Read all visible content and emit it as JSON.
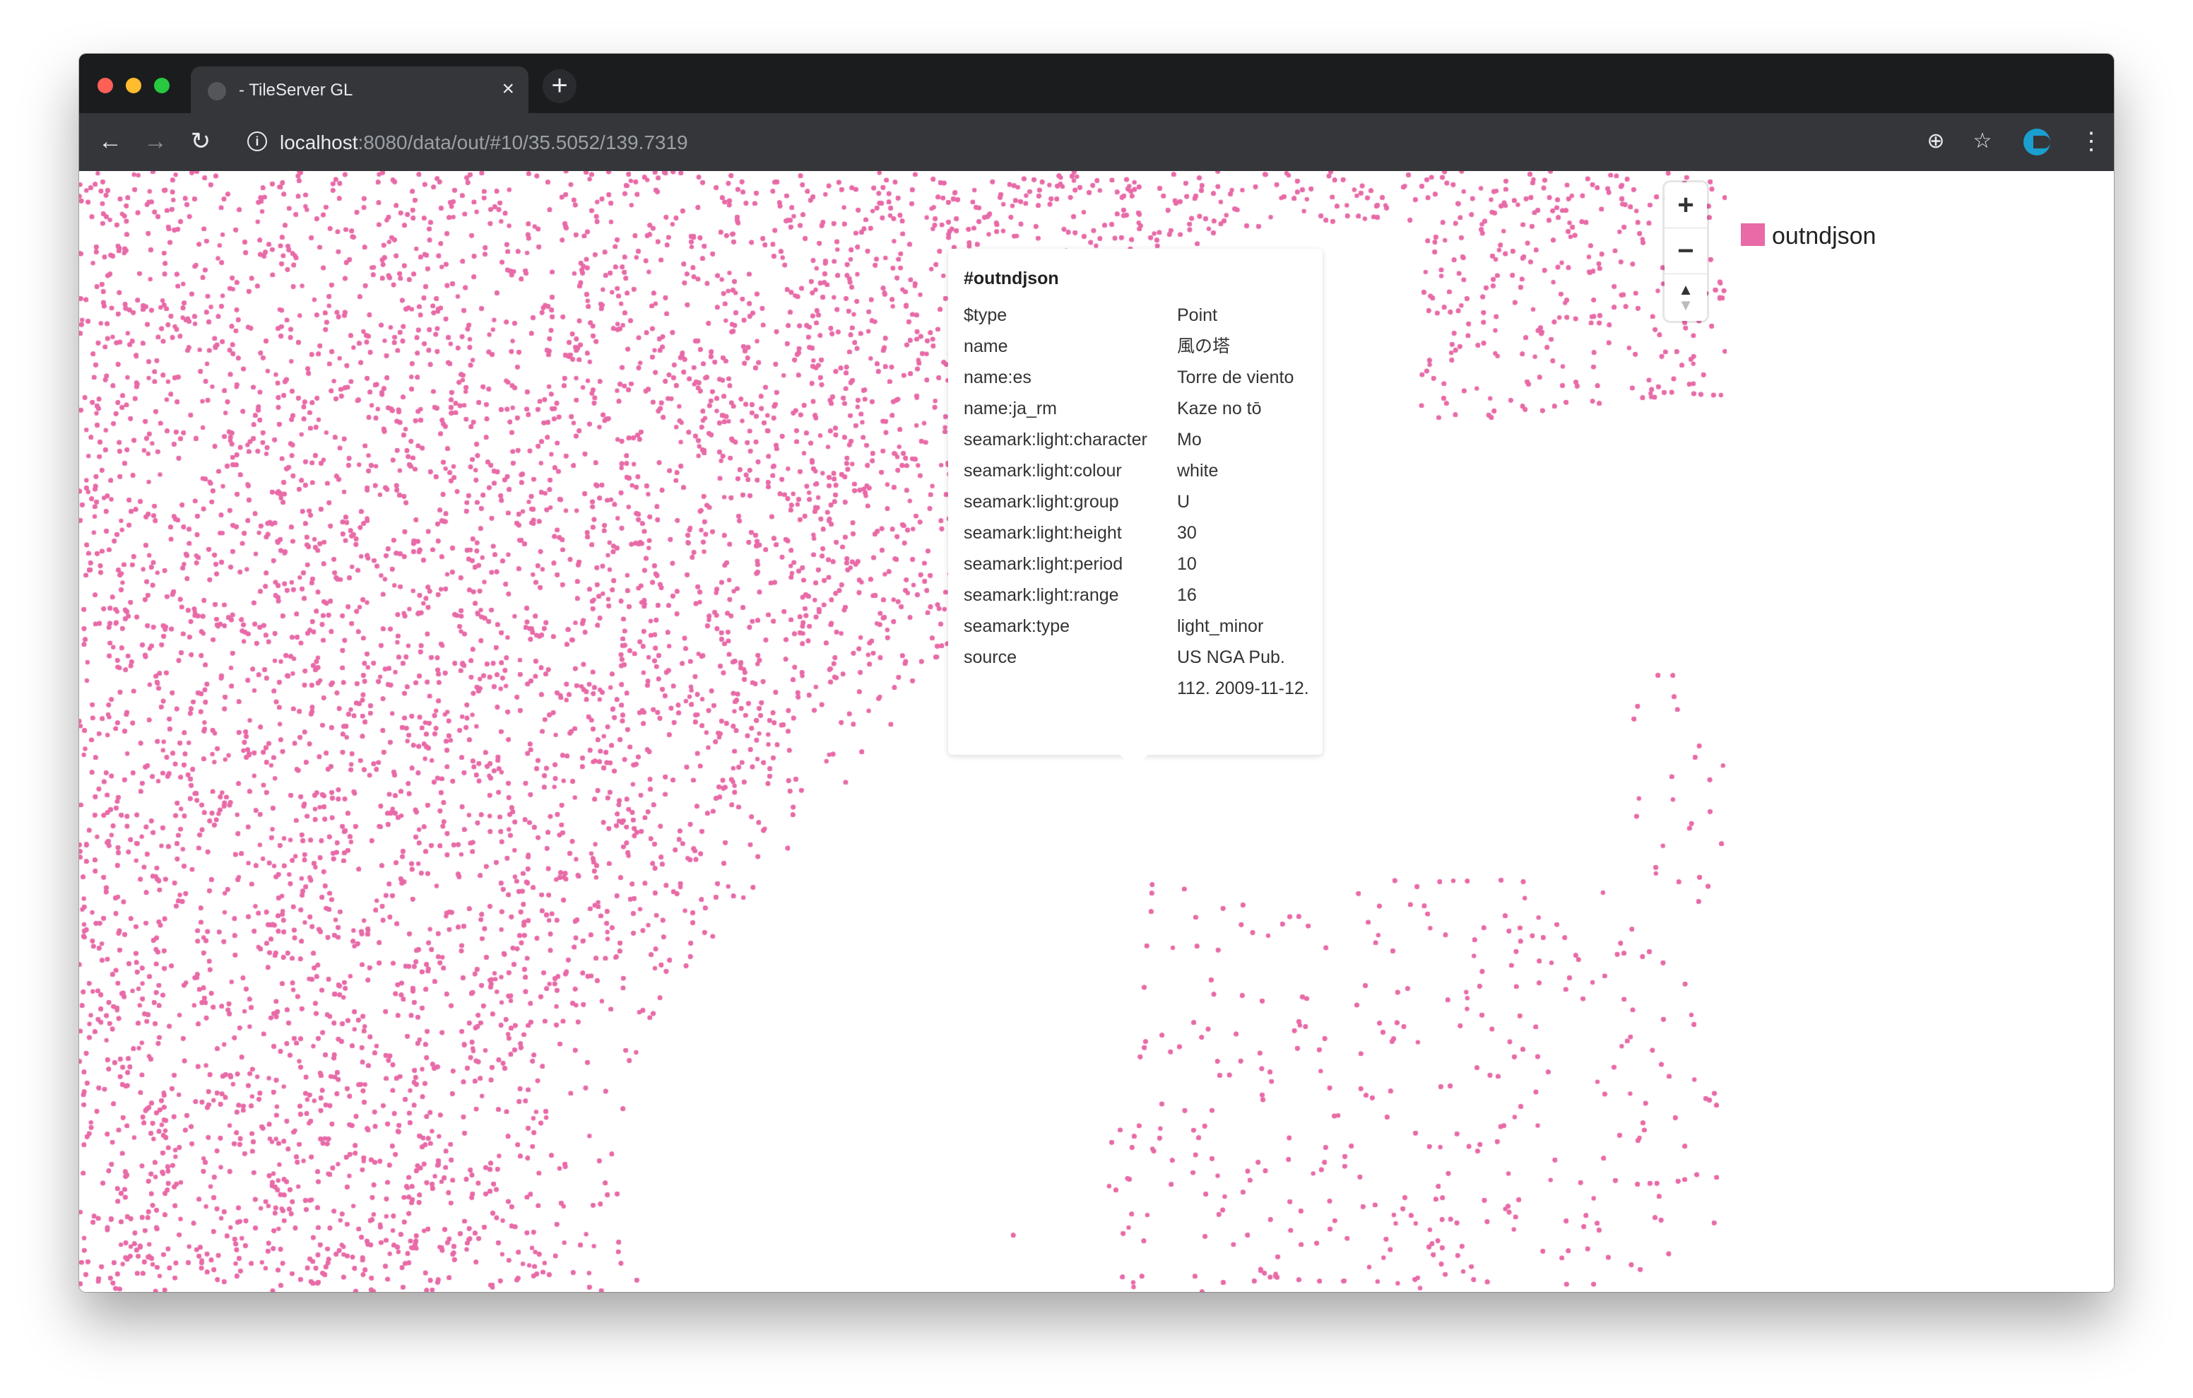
{
  "browser": {
    "tab_title": "- TileServer GL",
    "tab_close": "×",
    "new_tab": "+",
    "url_host": "localhost",
    "url_path": ":8080/data/out/#10/35.5052/139.7319"
  },
  "map": {
    "layer_color": "#e86aa7",
    "zoom_in": "+",
    "zoom_out": "−",
    "compass_north": "▲",
    "compass_south": "▼"
  },
  "popup": {
    "heading": "#outndjson",
    "properties": [
      {
        "key": "$type",
        "value": "Point"
      },
      {
        "key": "name",
        "value": "風の塔"
      },
      {
        "key": "name:es",
        "value": "Torre de viento"
      },
      {
        "key": "name:ja_rm",
        "value": "Kaze no tō"
      },
      {
        "key": "seamark:light:character",
        "value": "Mo"
      },
      {
        "key": "seamark:light:colour",
        "value": "white"
      },
      {
        "key": "seamark:light:group",
        "value": "U"
      },
      {
        "key": "seamark:light:height",
        "value": "30"
      },
      {
        "key": "seamark:light:period",
        "value": "10"
      },
      {
        "key": "seamark:light:range",
        "value": "16"
      },
      {
        "key": "seamark:type",
        "value": "light_minor"
      },
      {
        "key": "source",
        "value": "US NGA Pub. 112. 2009-11-12."
      }
    ]
  },
  "legend": {
    "label": "outndjson",
    "color": "#e86aa7"
  }
}
